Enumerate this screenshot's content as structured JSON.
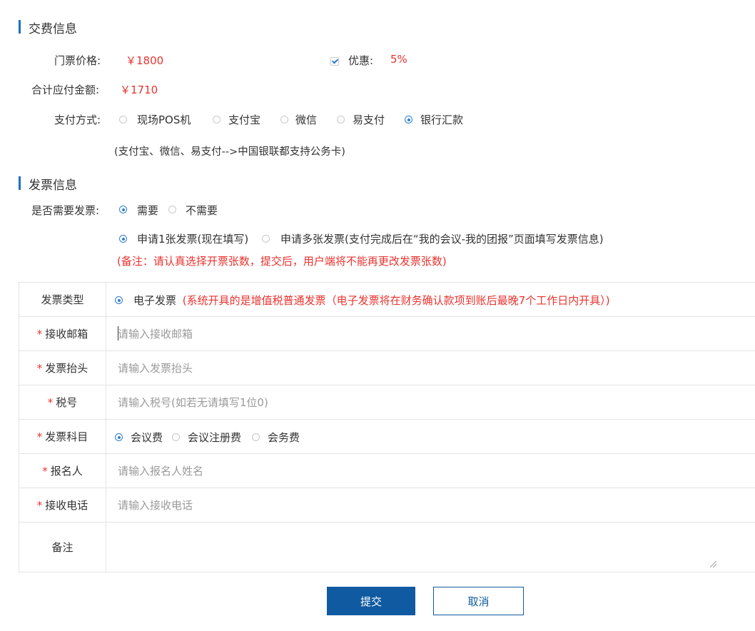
{
  "fee_section": {
    "title": "交费信息",
    "ticket_price_label": "门票价格:",
    "ticket_price_value": "￥1800",
    "discount_label": "优惠:",
    "discount_value": "5%",
    "total_label": "合计应付金额:",
    "total_value": "￥1710",
    "payment_label": "支付方式:",
    "payment_options": [
      {
        "label": "现场POS机",
        "selected": false
      },
      {
        "label": "支付宝",
        "selected": false
      },
      {
        "label": "微信",
        "selected": false
      },
      {
        "label": "易支付",
        "selected": false
      },
      {
        "label": "银行汇款",
        "selected": true
      }
    ],
    "payment_note": "(支付宝、微信、易支付-->中国银联都支持公务卡)"
  },
  "invoice_section": {
    "title": "发票信息",
    "need_label": "是否需要发票:",
    "need_options": [
      {
        "label": "需要",
        "selected": true
      },
      {
        "label": "不需要",
        "selected": false
      }
    ],
    "count_options": [
      {
        "label": "申请1张发票(现在填写)",
        "selected": true
      },
      {
        "label": "申请多张发票(支付完成后在“我的会议-我的团报”页面填写发票信息)",
        "selected": false
      }
    ],
    "remark": "(备注：请认真选择开票张数，提交后，用户端将不能再更改发票张数)"
  },
  "form": {
    "type_label": "发票类型",
    "type_option": "电子发票",
    "type_note": "(系统开具的是增值税普通发票（电子发票将在财务确认款项到账后最晚7个工作日内开具）)",
    "required_mark": "*",
    "email_label": "接收邮箱",
    "email_placeholder": "请输入接收邮箱",
    "title_label": "发票抬头",
    "title_placeholder": "请输入发票抬头",
    "tax_label": "税号",
    "tax_placeholder": "请输入税号(如若无请填写1位0)",
    "subject_label": "发票科目",
    "subject_options": [
      {
        "label": "会议费",
        "selected": true
      },
      {
        "label": "会议注册费",
        "selected": false
      },
      {
        "label": "会务费",
        "selected": false
      }
    ],
    "name_label": "报名人",
    "name_placeholder": "请输入报名人姓名",
    "phone_label": "接收电话",
    "phone_placeholder": "请输入接收电话",
    "remark_label": "备注",
    "remark_value": ""
  },
  "buttons": {
    "submit": "提交",
    "cancel": "取消"
  },
  "colors": {
    "accent": "#1f6fbf",
    "price_red": "#e8332f",
    "primary_button": "#0f5aa0"
  }
}
